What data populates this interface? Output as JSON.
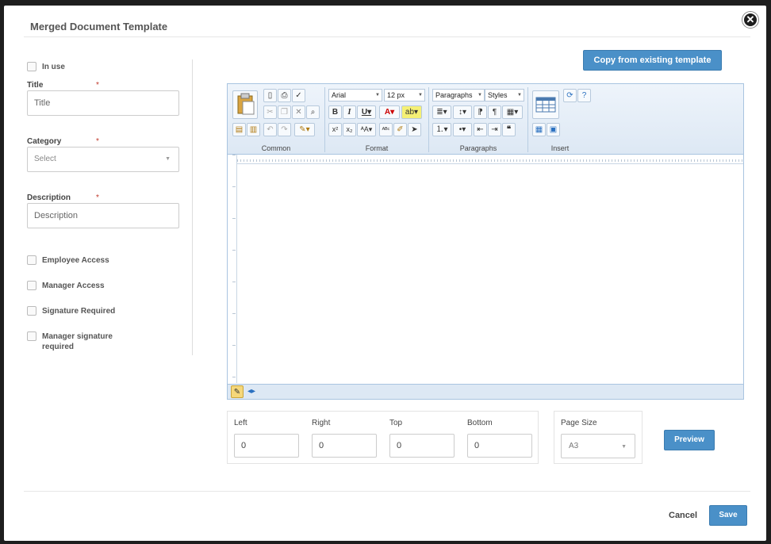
{
  "modal": {
    "title": "Merged Document Template",
    "close_icon": "close-icon"
  },
  "form": {
    "in_use_label": "In use",
    "title_label": "Title",
    "title_placeholder": "Title",
    "category_label": "Category",
    "category_value": "Select",
    "description_label": "Description",
    "description_placeholder": "Description",
    "required_mark": "*",
    "checkboxes": [
      {
        "label": "Employee Access",
        "checked": false
      },
      {
        "label": "Manager Access",
        "checked": false
      },
      {
        "label": "Signature Required",
        "checked": false
      },
      {
        "label": "Manager signature required",
        "checked": false
      }
    ]
  },
  "copy_button_label": "Copy from existing template",
  "editor": {
    "font_value": "Arial",
    "size_value": "12 px",
    "paragraph_value": "Paragraphs",
    "styles_value": "Styles",
    "groups": [
      "Common",
      "Format",
      "Paragraphs",
      "Insert"
    ]
  },
  "margins": {
    "left_label": "Left",
    "left_value": "0",
    "right_label": "Right",
    "right_value": "0",
    "top_label": "Top",
    "top_value": "0",
    "bottom_label": "Bottom",
    "bottom_value": "0"
  },
  "page_size": {
    "label": "Page Size",
    "value": "A3"
  },
  "buttons": {
    "preview": "Preview",
    "cancel": "Cancel",
    "save": "Save"
  },
  "colors": {
    "primary": "#4a90c8",
    "toolbar_bg": "#dde8f4",
    "required": "#c0392b"
  }
}
